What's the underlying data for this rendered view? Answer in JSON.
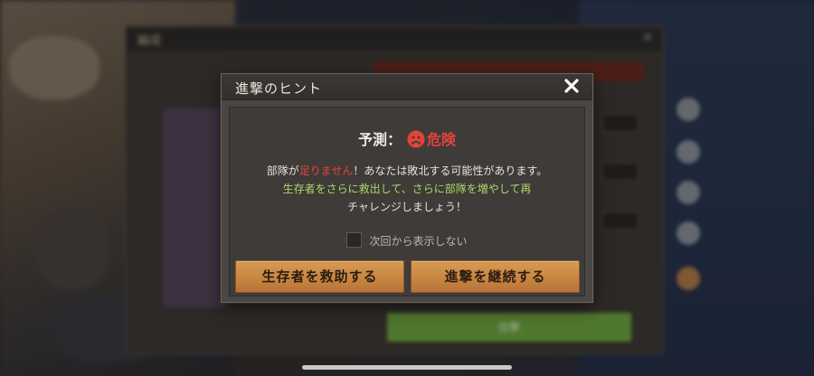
{
  "background": {
    "under_panel_title": "編成",
    "under_panel_button": "出撃"
  },
  "dialog": {
    "title": "進撃のヒント",
    "prediction": {
      "label": "予測：",
      "status": "危険",
      "status_icon": "sad-face-icon",
      "status_color": "#e5433a"
    },
    "message": {
      "line1_part1": "部隊が",
      "line1_highlight": "足りません",
      "line1_part2": "！あなたは敗北する可能性があります。",
      "line2": "生存者をさらに救出して、さらに部隊を増やして再",
      "line3": "チャレンジしましょう！"
    },
    "dont_show_again": "次回から表示しない",
    "buttons": {
      "rescue": "生存者を救助する",
      "continue": "進撃を継続する"
    },
    "close_icon": "close-icon"
  },
  "colors": {
    "accent_button": "#c98640",
    "danger": "#e5433a",
    "hint_green": "#a8d86a"
  }
}
